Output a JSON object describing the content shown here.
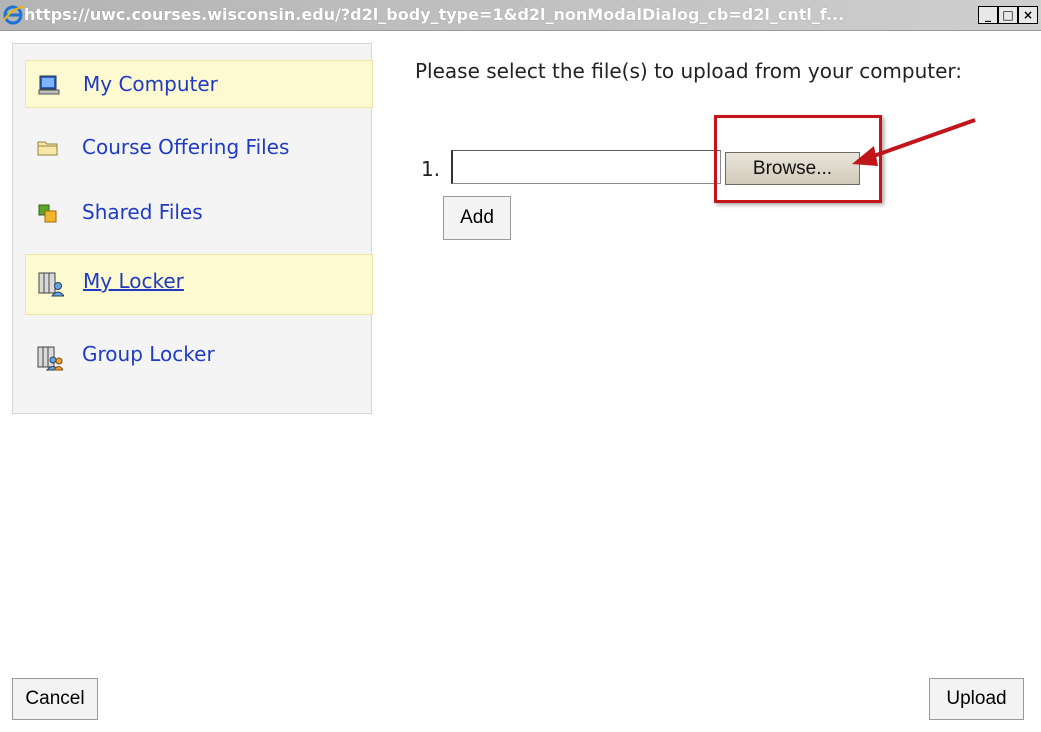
{
  "window": {
    "title": "https://uwc.courses.wisconsin.edu/?d2l_body_type=1&d2l_nonModalDialog_cb=d2l_cntl_f...",
    "minimize_label": "_",
    "maximize_label": "□",
    "close_label": "×"
  },
  "sidebar": {
    "items": [
      {
        "label": "My Computer",
        "icon": "computer-icon",
        "active": true
      },
      {
        "label": "Course Offering Files",
        "icon": "folder-icon",
        "active": false
      },
      {
        "label": "Shared Files",
        "icon": "shared-files-icon",
        "active": false
      },
      {
        "label": "My Locker",
        "icon": "locker-icon",
        "active": true
      },
      {
        "label": "Group Locker",
        "icon": "group-locker-icon",
        "active": false
      }
    ]
  },
  "main": {
    "prompt": "Please select the file(s) to upload from your computer:",
    "file_rows": [
      {
        "number": "1.",
        "value": "",
        "browse_label": "Browse..."
      }
    ],
    "add_label": "Add"
  },
  "footer": {
    "cancel_label": "Cancel",
    "upload_label": "Upload"
  },
  "colors": {
    "link": "#1f3bc2",
    "active_item_bg": "#fdf9d1",
    "highlight": "#c2151b"
  }
}
